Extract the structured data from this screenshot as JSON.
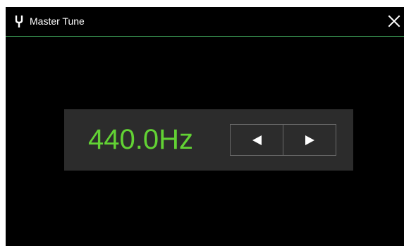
{
  "window": {
    "title": "Master Tune",
    "icon": "tuning-fork-icon",
    "close_icon": "close-icon"
  },
  "tune": {
    "value": "440.0Hz",
    "decrease_icon": "triangle-left-icon",
    "increase_icon": "triangle-right-icon"
  },
  "colors": {
    "background": "#000000",
    "accent_line": "#3fa55a",
    "value_text": "#62d234",
    "panel": "#2c2c2c",
    "title_text": "#ffffff"
  }
}
